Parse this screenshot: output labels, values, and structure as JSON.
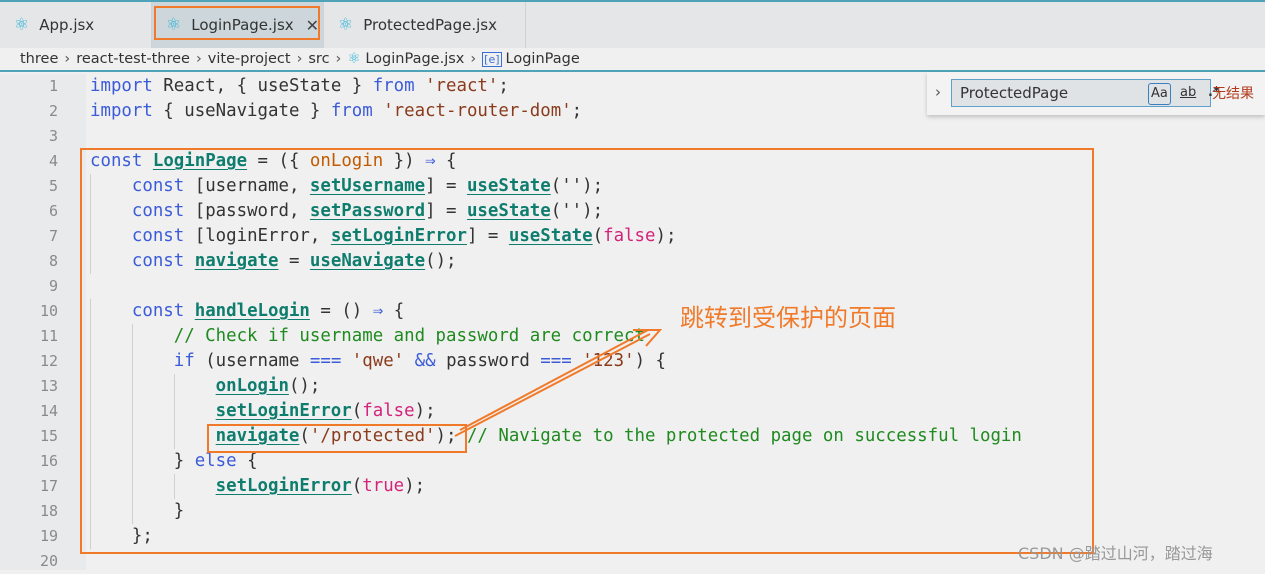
{
  "tabs": [
    {
      "label": "App.jsx",
      "icon": "react-icon",
      "active": false
    },
    {
      "label": "LoginPage.jsx",
      "icon": "react-icon",
      "active": true
    },
    {
      "label": "ProtectedPage.jsx",
      "icon": "react-icon",
      "active": false
    }
  ],
  "breadcrumb": [
    "three",
    "react-test-three",
    "vite-project",
    "src",
    "LoginPage.jsx",
    "LoginPage"
  ],
  "find": {
    "value": "ProtectedPage",
    "match_case": "Aa",
    "whole_word": "ab",
    "regex": ".*",
    "result": "无结果"
  },
  "annotation": {
    "text": "跳转到受保护的页面",
    "color": "#f07a2a"
  },
  "watermark": "CSDN @踏过山河，踏过海",
  "code": [
    [
      [
        "kw",
        "import"
      ],
      [
        "plain",
        " React, { useState } "
      ],
      [
        "kw",
        "from"
      ],
      [
        "plain",
        " "
      ],
      [
        "str",
        "'react'"
      ],
      [
        "plain",
        ";"
      ]
    ],
    [
      [
        "kw",
        "import"
      ],
      [
        "plain",
        " { useNavigate } "
      ],
      [
        "kw",
        "from"
      ],
      [
        "plain",
        " "
      ],
      [
        "str",
        "'react-router-dom'"
      ],
      [
        "plain",
        ";"
      ]
    ],
    [],
    [
      [
        "kw",
        "const"
      ],
      [
        "plain",
        " "
      ],
      [
        "fn",
        "LoginPage"
      ],
      [
        "plain",
        " = ({ "
      ],
      [
        "param",
        "onLogin"
      ],
      [
        "plain",
        " }) "
      ],
      [
        "op",
        "⇒"
      ],
      [
        "plain",
        " {"
      ]
    ],
    [
      [
        "plain",
        "    "
      ],
      [
        "kw",
        "const"
      ],
      [
        "plain",
        " [username, "
      ],
      [
        "fn",
        "setUsername"
      ],
      [
        "plain",
        "] = "
      ],
      [
        "fn",
        "useState"
      ],
      [
        "plain",
        "('');"
      ]
    ],
    [
      [
        "plain",
        "    "
      ],
      [
        "kw",
        "const"
      ],
      [
        "plain",
        " [password, "
      ],
      [
        "fn",
        "setPassword"
      ],
      [
        "plain",
        "] = "
      ],
      [
        "fn",
        "useState"
      ],
      [
        "plain",
        "('');"
      ]
    ],
    [
      [
        "plain",
        "    "
      ],
      [
        "kw",
        "const"
      ],
      [
        "plain",
        " [loginError, "
      ],
      [
        "fn",
        "setLoginError"
      ],
      [
        "plain",
        "] = "
      ],
      [
        "fn",
        "useState"
      ],
      [
        "plain",
        "("
      ],
      [
        "bool",
        "false"
      ],
      [
        "plain",
        ");"
      ]
    ],
    [
      [
        "plain",
        "    "
      ],
      [
        "kw",
        "const"
      ],
      [
        "plain",
        " "
      ],
      [
        "fn",
        "navigate"
      ],
      [
        "plain",
        " = "
      ],
      [
        "fn",
        "useNavigate"
      ],
      [
        "plain",
        "();"
      ]
    ],
    [],
    [
      [
        "plain",
        "    "
      ],
      [
        "kw",
        "const"
      ],
      [
        "plain",
        " "
      ],
      [
        "fn",
        "handleLogin"
      ],
      [
        "plain",
        " = () "
      ],
      [
        "op",
        "⇒"
      ],
      [
        "plain",
        " {"
      ]
    ],
    [
      [
        "plain",
        "        "
      ],
      [
        "cmt",
        "// Check if username and password are correct"
      ]
    ],
    [
      [
        "plain",
        "        "
      ],
      [
        "kw",
        "if"
      ],
      [
        "plain",
        " (username "
      ],
      [
        "op",
        "==="
      ],
      [
        "plain",
        " "
      ],
      [
        "str",
        "'qwe'"
      ],
      [
        "plain",
        " "
      ],
      [
        "op",
        "&&"
      ],
      [
        "plain",
        " password "
      ],
      [
        "op",
        "==="
      ],
      [
        "plain",
        " "
      ],
      [
        "str",
        "'123'"
      ],
      [
        "plain",
        ") {"
      ]
    ],
    [
      [
        "plain",
        "            "
      ],
      [
        "fn",
        "onLogin"
      ],
      [
        "plain",
        "();"
      ]
    ],
    [
      [
        "plain",
        "            "
      ],
      [
        "fn",
        "setLoginError"
      ],
      [
        "plain",
        "("
      ],
      [
        "bool",
        "false"
      ],
      [
        "plain",
        ");"
      ]
    ],
    [
      [
        "plain",
        "            "
      ],
      [
        "fn",
        "navigate"
      ],
      [
        "plain",
        "("
      ],
      [
        "str",
        "'/protected'"
      ],
      [
        "plain",
        "); "
      ],
      [
        "cmt",
        "// Navigate to the protected page on successful login"
      ]
    ],
    [
      [
        "plain",
        "        } "
      ],
      [
        "kw",
        "else"
      ],
      [
        "plain",
        " {"
      ]
    ],
    [
      [
        "plain",
        "            "
      ],
      [
        "fn",
        "setLoginError"
      ],
      [
        "plain",
        "("
      ],
      [
        "bool",
        "true"
      ],
      [
        "plain",
        ");"
      ]
    ],
    [
      [
        "plain",
        "        }"
      ]
    ],
    [
      [
        "plain",
        "    };"
      ]
    ],
    []
  ]
}
